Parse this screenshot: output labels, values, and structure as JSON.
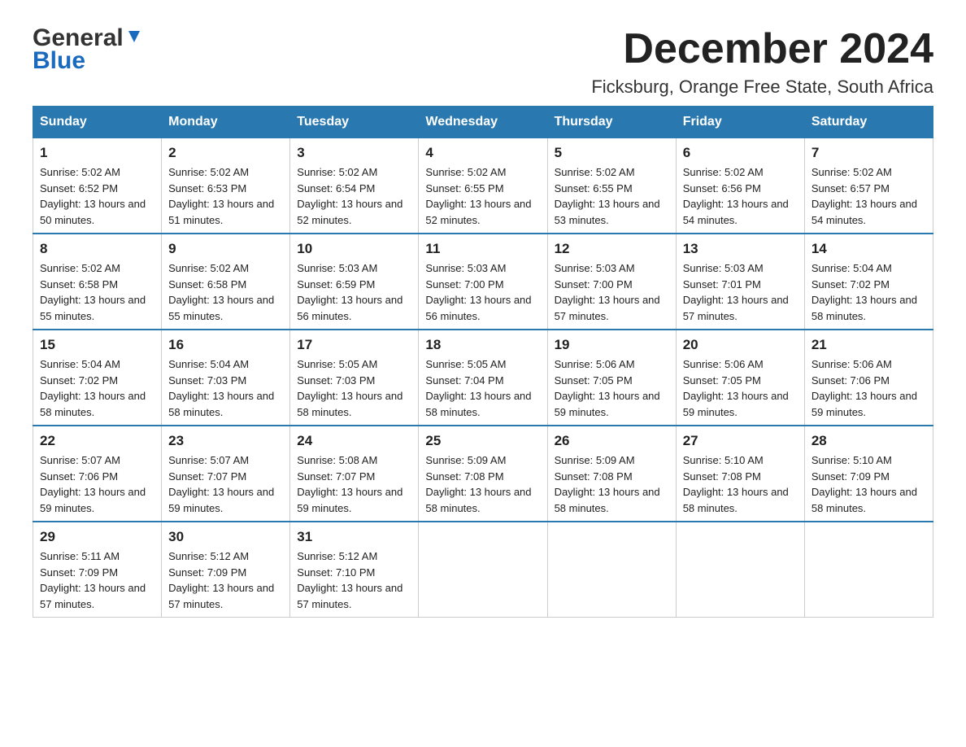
{
  "header": {
    "logo_general": "General",
    "logo_blue": "Blue",
    "month_title": "December 2024",
    "location": "Ficksburg, Orange Free State, South Africa"
  },
  "days_of_week": [
    "Sunday",
    "Monday",
    "Tuesday",
    "Wednesday",
    "Thursday",
    "Friday",
    "Saturday"
  ],
  "weeks": [
    [
      {
        "num": "1",
        "sunrise": "5:02 AM",
        "sunset": "6:52 PM",
        "daylight": "13 hours and 50 minutes."
      },
      {
        "num": "2",
        "sunrise": "5:02 AM",
        "sunset": "6:53 PM",
        "daylight": "13 hours and 51 minutes."
      },
      {
        "num": "3",
        "sunrise": "5:02 AM",
        "sunset": "6:54 PM",
        "daylight": "13 hours and 52 minutes."
      },
      {
        "num": "4",
        "sunrise": "5:02 AM",
        "sunset": "6:55 PM",
        "daylight": "13 hours and 52 minutes."
      },
      {
        "num": "5",
        "sunrise": "5:02 AM",
        "sunset": "6:55 PM",
        "daylight": "13 hours and 53 minutes."
      },
      {
        "num": "6",
        "sunrise": "5:02 AM",
        "sunset": "6:56 PM",
        "daylight": "13 hours and 54 minutes."
      },
      {
        "num": "7",
        "sunrise": "5:02 AM",
        "sunset": "6:57 PM",
        "daylight": "13 hours and 54 minutes."
      }
    ],
    [
      {
        "num": "8",
        "sunrise": "5:02 AM",
        "sunset": "6:58 PM",
        "daylight": "13 hours and 55 minutes."
      },
      {
        "num": "9",
        "sunrise": "5:02 AM",
        "sunset": "6:58 PM",
        "daylight": "13 hours and 55 minutes."
      },
      {
        "num": "10",
        "sunrise": "5:03 AM",
        "sunset": "6:59 PM",
        "daylight": "13 hours and 56 minutes."
      },
      {
        "num": "11",
        "sunrise": "5:03 AM",
        "sunset": "7:00 PM",
        "daylight": "13 hours and 56 minutes."
      },
      {
        "num": "12",
        "sunrise": "5:03 AM",
        "sunset": "7:00 PM",
        "daylight": "13 hours and 57 minutes."
      },
      {
        "num": "13",
        "sunrise": "5:03 AM",
        "sunset": "7:01 PM",
        "daylight": "13 hours and 57 minutes."
      },
      {
        "num": "14",
        "sunrise": "5:04 AM",
        "sunset": "7:02 PM",
        "daylight": "13 hours and 58 minutes."
      }
    ],
    [
      {
        "num": "15",
        "sunrise": "5:04 AM",
        "sunset": "7:02 PM",
        "daylight": "13 hours and 58 minutes."
      },
      {
        "num": "16",
        "sunrise": "5:04 AM",
        "sunset": "7:03 PM",
        "daylight": "13 hours and 58 minutes."
      },
      {
        "num": "17",
        "sunrise": "5:05 AM",
        "sunset": "7:03 PM",
        "daylight": "13 hours and 58 minutes."
      },
      {
        "num": "18",
        "sunrise": "5:05 AM",
        "sunset": "7:04 PM",
        "daylight": "13 hours and 58 minutes."
      },
      {
        "num": "19",
        "sunrise": "5:06 AM",
        "sunset": "7:05 PM",
        "daylight": "13 hours and 59 minutes."
      },
      {
        "num": "20",
        "sunrise": "5:06 AM",
        "sunset": "7:05 PM",
        "daylight": "13 hours and 59 minutes."
      },
      {
        "num": "21",
        "sunrise": "5:06 AM",
        "sunset": "7:06 PM",
        "daylight": "13 hours and 59 minutes."
      }
    ],
    [
      {
        "num": "22",
        "sunrise": "5:07 AM",
        "sunset": "7:06 PM",
        "daylight": "13 hours and 59 minutes."
      },
      {
        "num": "23",
        "sunrise": "5:07 AM",
        "sunset": "7:07 PM",
        "daylight": "13 hours and 59 minutes."
      },
      {
        "num": "24",
        "sunrise": "5:08 AM",
        "sunset": "7:07 PM",
        "daylight": "13 hours and 59 minutes."
      },
      {
        "num": "25",
        "sunrise": "5:09 AM",
        "sunset": "7:08 PM",
        "daylight": "13 hours and 58 minutes."
      },
      {
        "num": "26",
        "sunrise": "5:09 AM",
        "sunset": "7:08 PM",
        "daylight": "13 hours and 58 minutes."
      },
      {
        "num": "27",
        "sunrise": "5:10 AM",
        "sunset": "7:08 PM",
        "daylight": "13 hours and 58 minutes."
      },
      {
        "num": "28",
        "sunrise": "5:10 AM",
        "sunset": "7:09 PM",
        "daylight": "13 hours and 58 minutes."
      }
    ],
    [
      {
        "num": "29",
        "sunrise": "5:11 AM",
        "sunset": "7:09 PM",
        "daylight": "13 hours and 57 minutes."
      },
      {
        "num": "30",
        "sunrise": "5:12 AM",
        "sunset": "7:09 PM",
        "daylight": "13 hours and 57 minutes."
      },
      {
        "num": "31",
        "sunrise": "5:12 AM",
        "sunset": "7:10 PM",
        "daylight": "13 hours and 57 minutes."
      },
      null,
      null,
      null,
      null
    ]
  ]
}
